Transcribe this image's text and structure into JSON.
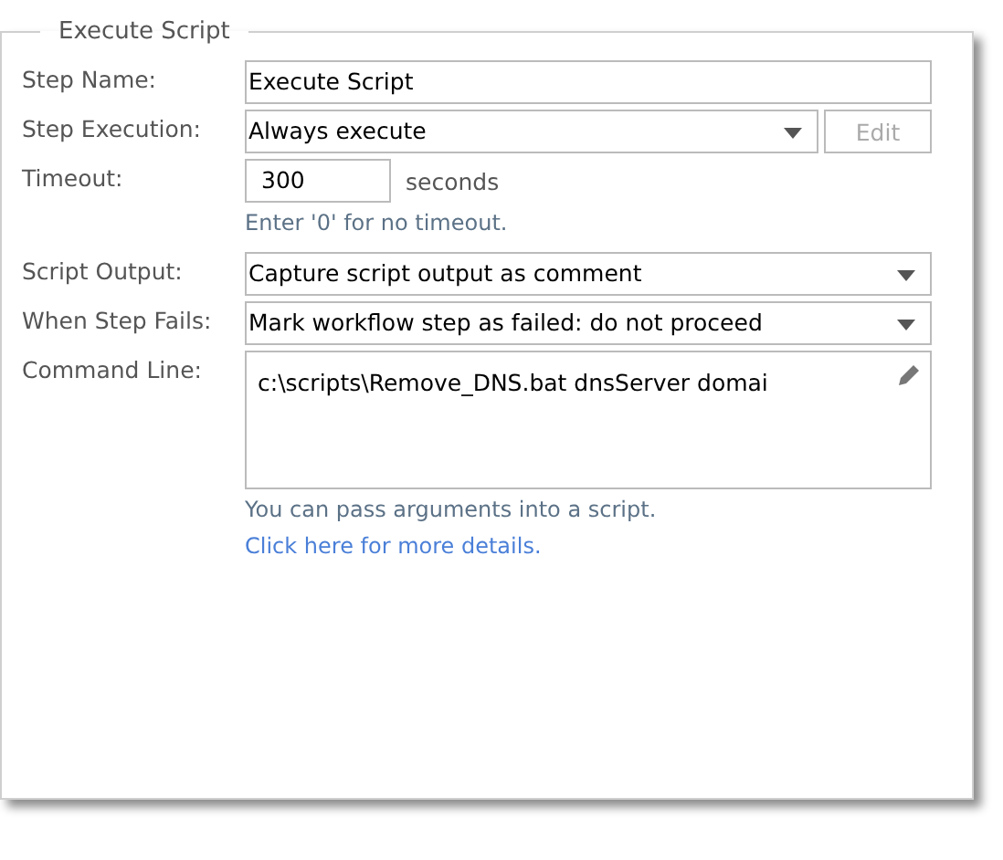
{
  "panel": {
    "title": "Execute Script"
  },
  "fields": [
    {
      "kind": "text",
      "label": "Step Name:",
      "value": "Execute Script"
    },
    {
      "kind": "select",
      "label": "Step Execution:",
      "value": "Always execute",
      "button": {
        "label": "Edit",
        "disabled": true
      }
    },
    {
      "kind": "number",
      "label": "Timeout:",
      "value": "300",
      "unit": "seconds",
      "hint": "Enter '0' for no timeout."
    },
    {
      "kind": "select",
      "label": "Script Output:",
      "value": "Capture script output as comment"
    },
    {
      "kind": "select",
      "label": "When Step Fails:",
      "value": "Mark workflow step as failed: do not proceed"
    },
    {
      "kind": "textarea",
      "label": "Command Line:",
      "value": "c:\\scripts\\Remove_DNS.bat dnsServer domai",
      "hint": "You can pass arguments into a script.",
      "link": "Click here for more details."
    }
  ]
}
